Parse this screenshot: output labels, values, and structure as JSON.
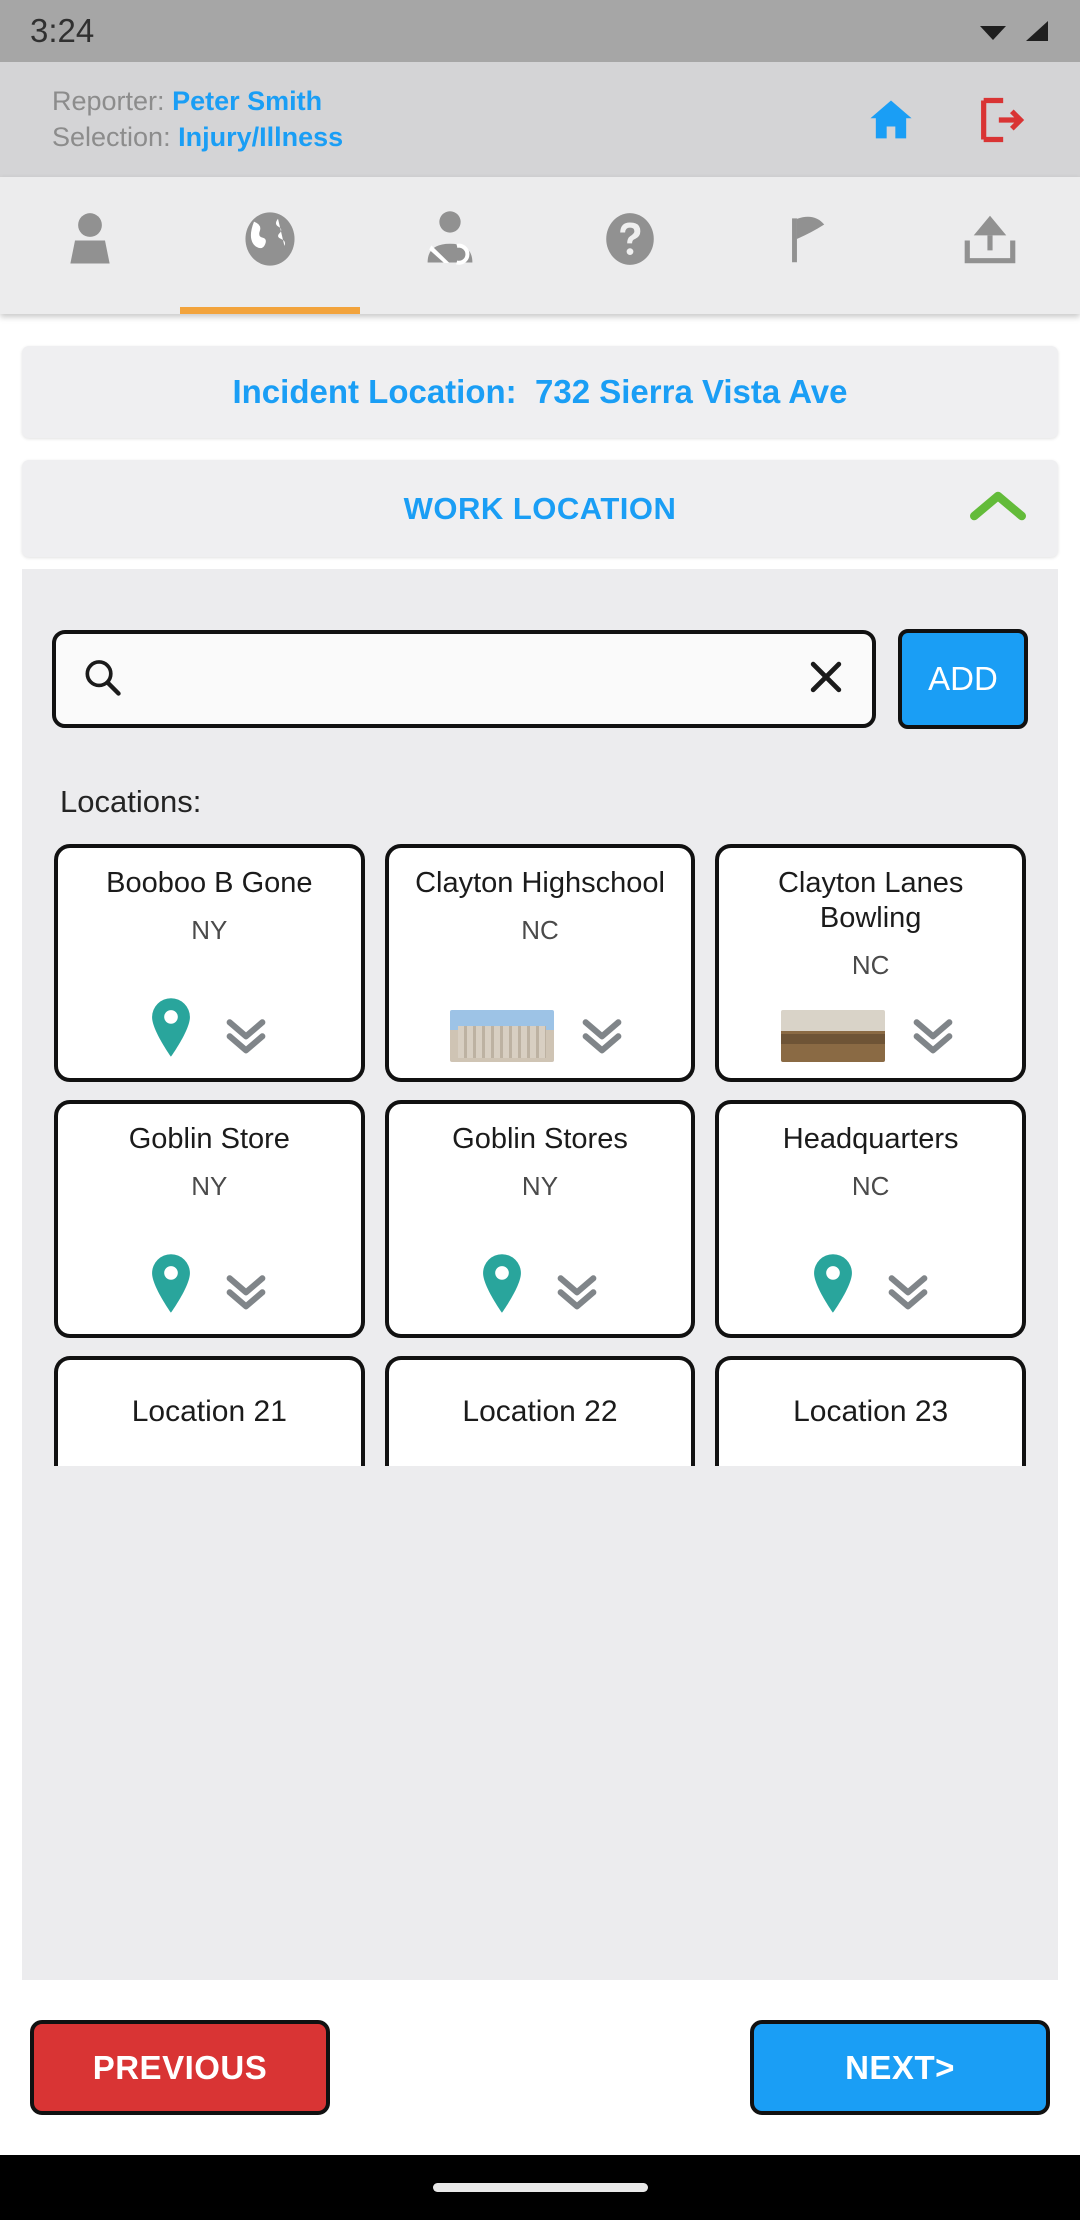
{
  "status_bar": {
    "time": "3:24",
    "wifi_icon": "wifi-icon",
    "signal_icon": "signal-icon"
  },
  "header": {
    "reporter_label": "Reporter:",
    "reporter_value": "Peter Smith",
    "selection_label": "Selection:",
    "selection_value": "Injury/Illness",
    "home_icon": "home-icon",
    "logout_icon": "logout-icon",
    "accent_color": "#1a9ef5",
    "logout_color": "#d93434"
  },
  "tabs": [
    {
      "name": "tab-person",
      "icon": "person-icon",
      "active": false
    },
    {
      "name": "tab-location",
      "icon": "globe-icon",
      "active": true
    },
    {
      "name": "tab-injury",
      "icon": "injured-person-icon",
      "active": false
    },
    {
      "name": "tab-help",
      "icon": "question-mark-icon",
      "active": false
    },
    {
      "name": "tab-report",
      "icon": "megaphone-icon",
      "active": false
    },
    {
      "name": "tab-submit",
      "icon": "upload-icon",
      "active": false
    }
  ],
  "incident": {
    "label": "Incident Location:",
    "value": "732 Sierra Vista Ave"
  },
  "section": {
    "title": "WORK LOCATION",
    "collapse_icon": "chevron-up-icon",
    "collapse_color": "#63bb3a"
  },
  "search": {
    "value": "",
    "placeholder": "",
    "search_icon": "search-icon",
    "clear_icon": "close-icon",
    "add_label": "ADD"
  },
  "locations_label": "Locations:",
  "locations": [
    {
      "name": "Booboo B Gone",
      "state": "NY",
      "media": "pin",
      "expand_icon": "double-chevron-down-icon"
    },
    {
      "name": "Clayton Highschool",
      "state": "NC",
      "media": "photo-building",
      "expand_icon": "double-chevron-down-icon"
    },
    {
      "name": "Clayton Lanes Bowling",
      "state": "NC",
      "media": "photo-interior",
      "expand_icon": "double-chevron-down-icon"
    },
    {
      "name": "Goblin Store",
      "state": "NY",
      "media": "pin",
      "expand_icon": "double-chevron-down-icon"
    },
    {
      "name": "Goblin Stores",
      "state": "NY",
      "media": "pin",
      "expand_icon": "double-chevron-down-icon"
    },
    {
      "name": "Headquarters",
      "state": "NC",
      "media": "pin",
      "expand_icon": "double-chevron-down-icon"
    },
    {
      "name": "Location 21",
      "state": "",
      "media": "",
      "expand_icon": ""
    },
    {
      "name": "Location 22",
      "state": "",
      "media": "",
      "expand_icon": ""
    },
    {
      "name": "Location 23",
      "state": "",
      "media": "",
      "expand_icon": ""
    }
  ],
  "footer": {
    "previous_label": "PREVIOUS",
    "next_label": "NEXT>",
    "previous_color": "#d93434",
    "next_color": "#1a9ef5"
  }
}
